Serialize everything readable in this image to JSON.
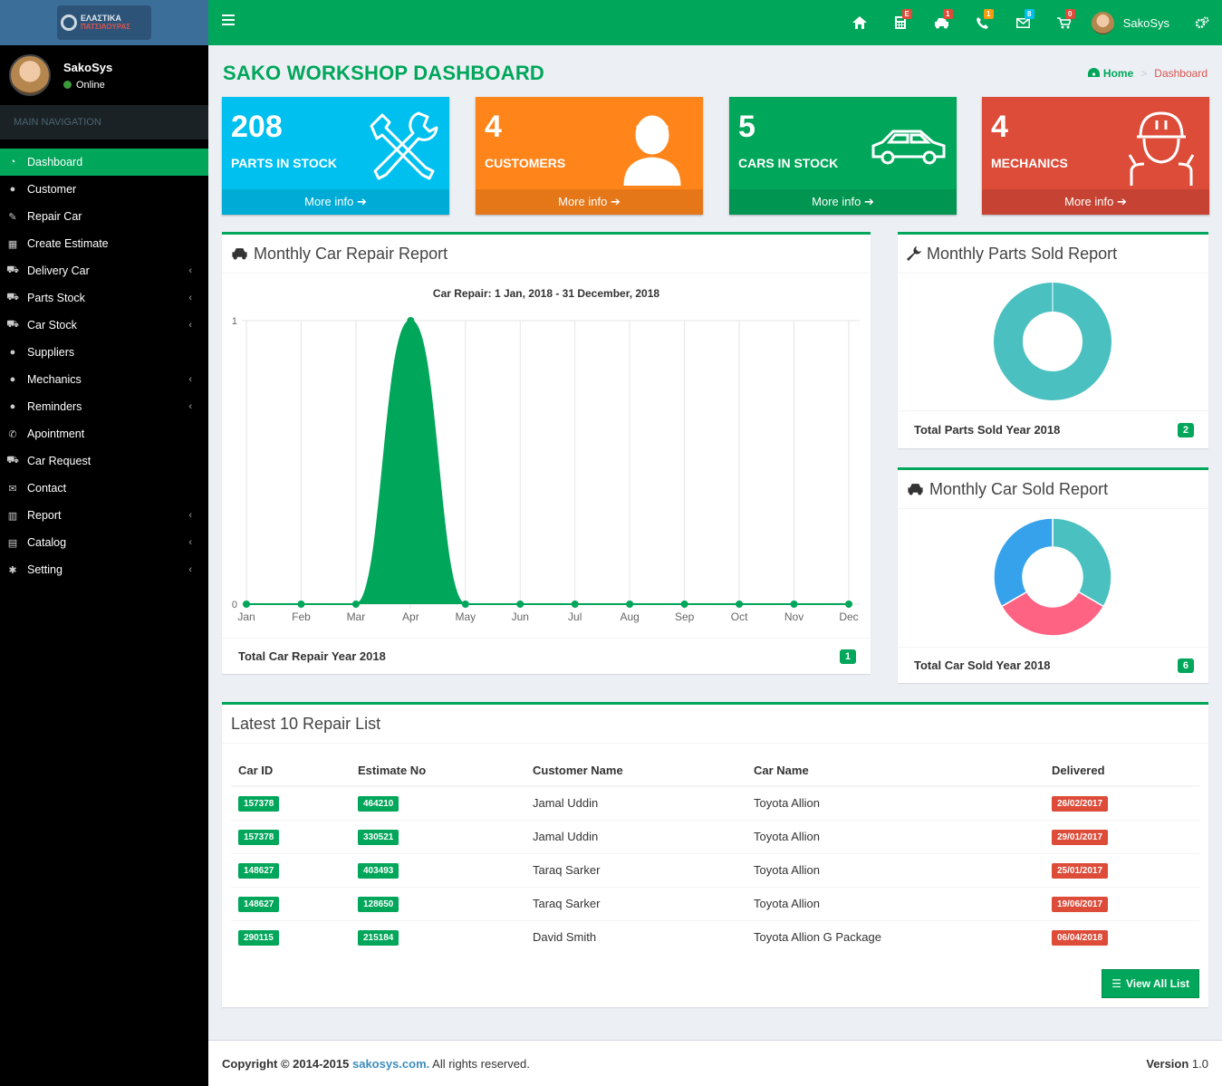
{
  "app": {
    "logo": {
      "line1": "ΕΛΑΣΤΙΚΑ",
      "line2": "ΠΑΤΣΙΑΟΥΡΑΣ"
    },
    "user": {
      "name": "SakoSys",
      "status": "Online"
    }
  },
  "sidebar": {
    "header": "MAIN NAVIGATION",
    "items": [
      {
        "label": "Dashboard",
        "icon": "dashboard-icon",
        "active": true
      },
      {
        "label": "Customer",
        "icon": "user-icon"
      },
      {
        "label": "Repair Car",
        "icon": "wrench-icon"
      },
      {
        "label": "Create Estimate",
        "icon": "calculator-icon"
      },
      {
        "label": "Delivery Car",
        "icon": "cart-icon",
        "caret": true
      },
      {
        "label": "Parts Stock",
        "icon": "truck-icon",
        "caret": true
      },
      {
        "label": "Car Stock",
        "icon": "car-icon",
        "caret": true
      },
      {
        "label": "Suppliers",
        "icon": "user-icon"
      },
      {
        "label": "Mechanics",
        "icon": "users-icon",
        "caret": true
      },
      {
        "label": "Reminders",
        "icon": "comment-icon",
        "caret": true
      },
      {
        "label": "Apointment",
        "icon": "phone-icon"
      },
      {
        "label": "Car Request",
        "icon": "car-icon"
      },
      {
        "label": "Contact",
        "icon": "envelope-icon"
      },
      {
        "label": "Report",
        "icon": "bar-chart-icon",
        "caret": true
      },
      {
        "label": "Catalog",
        "icon": "file-icon",
        "caret": true
      },
      {
        "label": "Setting",
        "icon": "cog-icon",
        "caret": true
      }
    ]
  },
  "topbar": {
    "badges": {
      "estimate": "E",
      "car": "1",
      "phone": "1",
      "mail": "8",
      "cart": "0"
    },
    "user_name": "SakoSys"
  },
  "page": {
    "title": "SAKO WORKSHOP DASHBOARD",
    "breadcrumb_home": "Home",
    "breadcrumb_current": "Dashboard"
  },
  "stats": [
    {
      "value": "208",
      "label": "PARTS IN STOCK",
      "more": "More info",
      "color": "#00c0ef"
    },
    {
      "value": "4",
      "label": "CUSTOMERS",
      "more": "More info",
      "color": "#ff851b"
    },
    {
      "value": "5",
      "label": "CARS IN STOCK",
      "more": "More info",
      "color": "#00a65a"
    },
    {
      "value": "4",
      "label": "MECHANICS",
      "more": "More info",
      "color": "#dd4b39"
    }
  ],
  "repair_report": {
    "title": "Monthly Car Repair Report",
    "chart_title": "Car Repair: 1 Jan, 2018 - 31 December, 2018",
    "footer_label": "Total Car Repair Year 2018",
    "footer_value": "1"
  },
  "parts_report": {
    "title": "Monthly Parts Sold Report",
    "footer_label": "Total Parts Sold Year 2018",
    "footer_value": "2"
  },
  "car_sold_report": {
    "title": "Monthly Car Sold Report",
    "footer_label": "Total Car Sold Year 2018",
    "footer_value": "6"
  },
  "chart_data": [
    {
      "type": "area",
      "title": "Car Repair: 1 Jan, 2018 - 31 December, 2018",
      "categories": [
        "Jan",
        "Feb",
        "Mar",
        "Apr",
        "May",
        "Jun",
        "Jul",
        "Aug",
        "Sep",
        "Oct",
        "Nov",
        "Dec"
      ],
      "values": [
        0,
        0,
        0,
        1,
        0,
        0,
        0,
        0,
        0,
        0,
        0,
        0
      ],
      "ylim": [
        0,
        1
      ],
      "yticks": [
        "0",
        "1"
      ],
      "color": "#00a65a",
      "grid": true
    },
    {
      "type": "pie",
      "values": [
        1
      ],
      "colors": [
        "#4bc0c0"
      ]
    },
    {
      "type": "pie",
      "values": [
        2,
        2,
        2
      ],
      "colors": [
        "#4bc0c0",
        "#ff6384",
        "#36a2eb"
      ]
    }
  ],
  "repair_list": {
    "title": "Latest 10 Repair List",
    "columns": [
      "Car ID",
      "Estimate No",
      "Customer Name",
      "Car Name",
      "Delivered"
    ],
    "rows": [
      {
        "car_id": "157378",
        "estimate": "464210",
        "customer": "Jamal Uddin",
        "car": "Toyota Allion",
        "delivered": "26/02/2017"
      },
      {
        "car_id": "157378",
        "estimate": "330521",
        "customer": "Jamal Uddin",
        "car": "Toyota Allion",
        "delivered": "29/01/2017"
      },
      {
        "car_id": "148627",
        "estimate": "403493",
        "customer": "Taraq Sarker",
        "car": "Toyota Allion",
        "delivered": "25/01/2017"
      },
      {
        "car_id": "148627",
        "estimate": "128650",
        "customer": "Taraq Sarker",
        "car": "Toyota Allion",
        "delivered": "19/06/2017"
      },
      {
        "car_id": "290115",
        "estimate": "215184",
        "customer": "David Smith",
        "car": "Toyota Allion G Package",
        "delivered": "06/04/2018"
      }
    ],
    "button": "View All List"
  },
  "footer": {
    "copyright": "Copyright © 2014-2015",
    "link": "sakosys.com.",
    "rights": "All rights reserved.",
    "version_label": "Version",
    "version": "1.0"
  }
}
